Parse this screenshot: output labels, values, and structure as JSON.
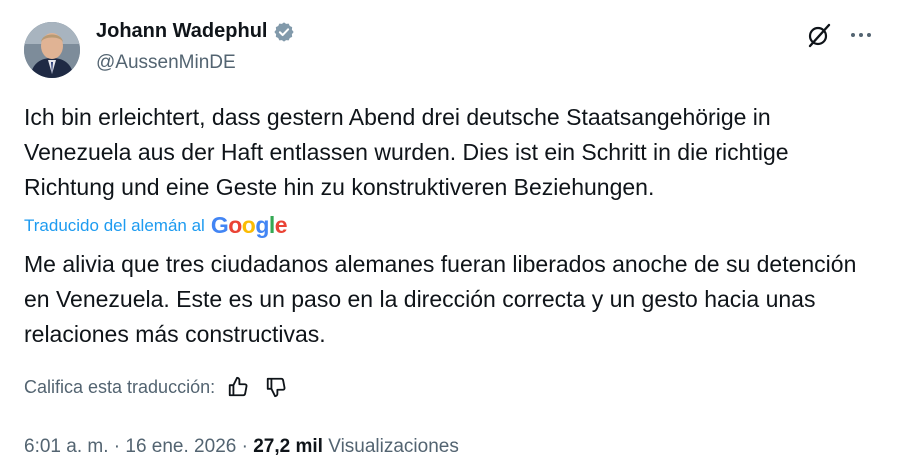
{
  "author": {
    "display_name": "Johann Wadephul",
    "handle": "@AussenMinDE",
    "verified_icon": "verified-badge-icon"
  },
  "tweet": {
    "original_text": "Ich bin erleichtert, dass gestern Abend drei deutsche Staatsangehörige in Venezuela aus der Haft entlassen wurden. Dies ist ein Schritt in die richtige Richtung und eine Geste hin zu konstruktiveren Beziehungen.",
    "translated_label": "Traducido del alemán al",
    "translation_provider": "Google",
    "translated_text": "Me alivia que tres ciudadanos alemanes fueran liberados anoche de su detención en Venezuela. Este es un paso en la dirección correcta y un gesto hacia unas relaciones más constructivas.",
    "rate_label": "Califica esta traducción:"
  },
  "meta": {
    "time": "6:01 a. m.",
    "separator": "·",
    "date": "16 ene. 2026",
    "views_count": "27,2 mil",
    "views_label": "Visualizaciones"
  },
  "colors": {
    "link": "#1d9bf0",
    "secondary_text": "#536471",
    "primary_text": "#0f1419"
  }
}
